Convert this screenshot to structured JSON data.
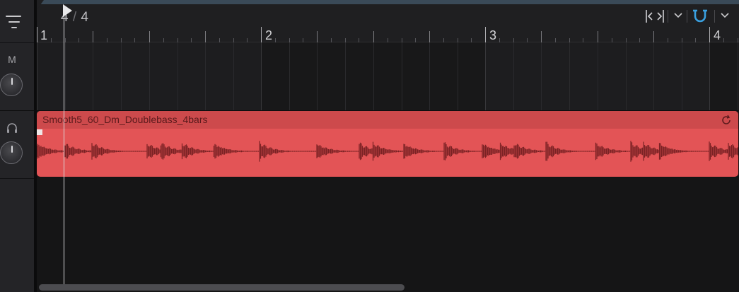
{
  "header": {
    "time_signature_top": "4",
    "time_signature_slash": "/",
    "time_signature_bottom": "4",
    "bar_numbers": [
      "1",
      "2",
      "3",
      "4"
    ]
  },
  "tracks": [
    {
      "mute_label": "M",
      "volume_icon": "knob-icon"
    },
    {
      "monitor_icon": "headphones-icon",
      "volume_icon": "knob-icon"
    }
  ],
  "region": {
    "name": "Smooth5_60_Dm_Doublebass_4bars",
    "loop_icon": "loop-icon",
    "color": "#e35456"
  },
  "controls": {
    "left_menu_icon": "menu-icon",
    "loop_nav_icon": "loop-brackets-icon",
    "snap_icon": "magnet-icon",
    "chevron_icon": "chevron-down-icon"
  },
  "colors": {
    "accent_blue": "#3aa0e0",
    "background": "#141415",
    "header_accent": "#3a4a58"
  }
}
